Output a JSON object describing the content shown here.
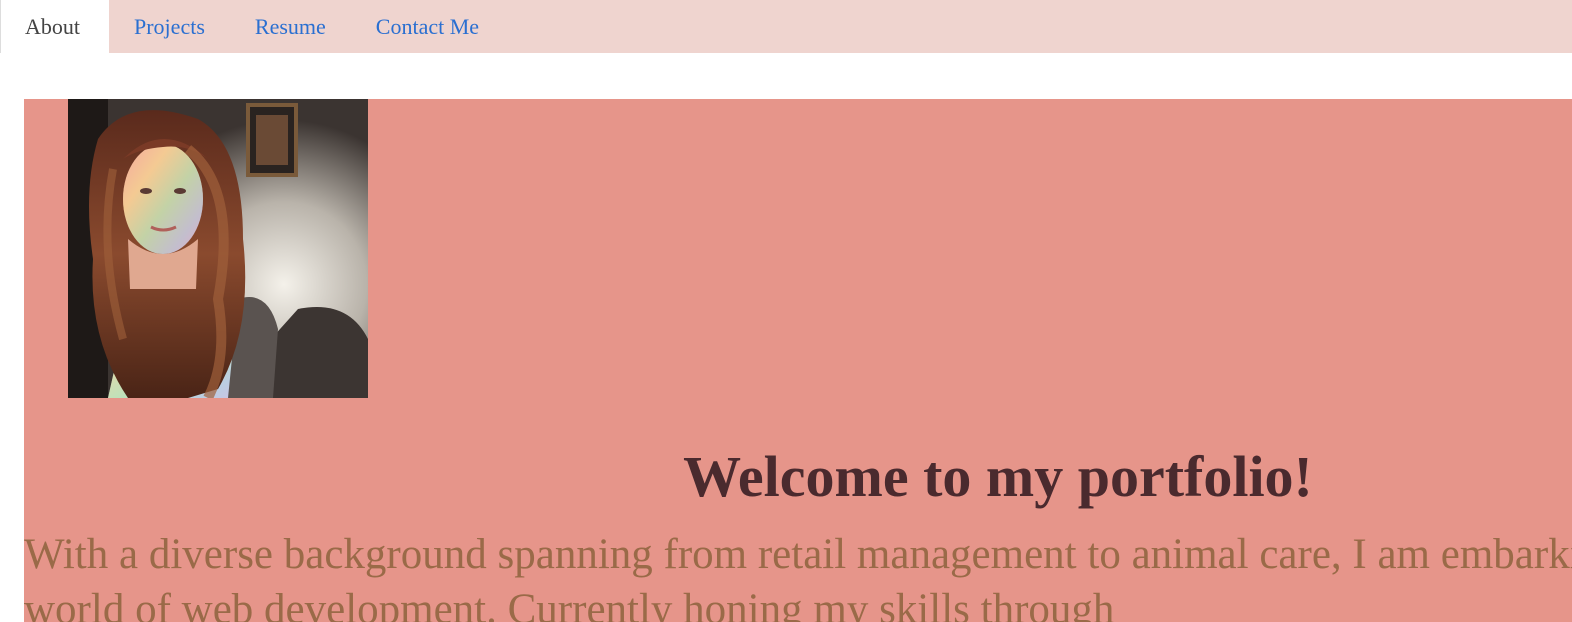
{
  "nav": {
    "tabs": [
      {
        "label": "About",
        "active": true
      },
      {
        "label": "Projects",
        "active": false
      },
      {
        "label": "Resume",
        "active": false
      },
      {
        "label": "Contact Me",
        "active": false
      }
    ]
  },
  "hero": {
    "heading": "Welcome to my portfolio!",
    "intro": "With a diverse background spanning from retail management to animal care, I am embarking on an exciting transition into the world of web development. Currently honing my skills through"
  },
  "colors": {
    "nav_background": "#efd4cf",
    "link": "#2a6fd1",
    "hero_background": "#e6958a",
    "heading": "#4a2a2e",
    "body_text": "#9a6a48"
  }
}
